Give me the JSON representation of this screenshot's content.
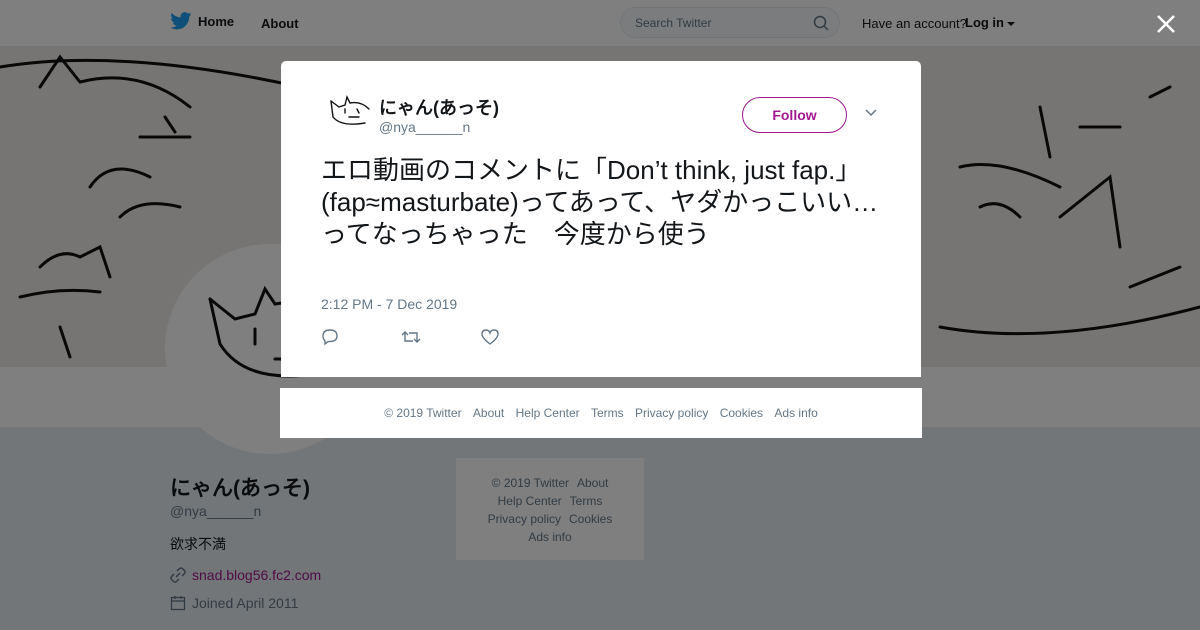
{
  "topbar": {
    "home_label": "Home",
    "about_label": "About",
    "search_placeholder": "Search Twitter",
    "account_prompt": "Have an account?",
    "login_label": "Log in"
  },
  "profile": {
    "name": "にゃん(あっそ)",
    "handle": "@nya______n",
    "bio": "欲求不満",
    "link": "snad.blog56.fc2.com",
    "joined": "Joined April 2011"
  },
  "side_footer": {
    "rows": [
      [
        "© 2019 Twitter",
        "About"
      ],
      [
        "Help Center",
        "Terms"
      ],
      [
        "Privacy policy",
        "Cookies"
      ],
      [
        "Ads info"
      ]
    ]
  },
  "tweet": {
    "name": "にゃん(あっそ)",
    "handle": "@nya______n",
    "follow_label": "Follow",
    "text": "エロ動画のコメントに「Don’t think, just fap.」(fap≈masturbate)ってあって、ヤダかっこいい…ってなっちゃった　今度から使う",
    "timestamp": "2:12 PM - 7 Dec 2019"
  },
  "modal_footer": {
    "items": [
      "© 2019 Twitter",
      "About",
      "Help Center",
      "Terms",
      "Privacy policy",
      "Cookies",
      "Ads info"
    ]
  },
  "colors": {
    "accent": "#a0198f",
    "twitter_blue": "#1da1f2",
    "muted": "#657786"
  }
}
